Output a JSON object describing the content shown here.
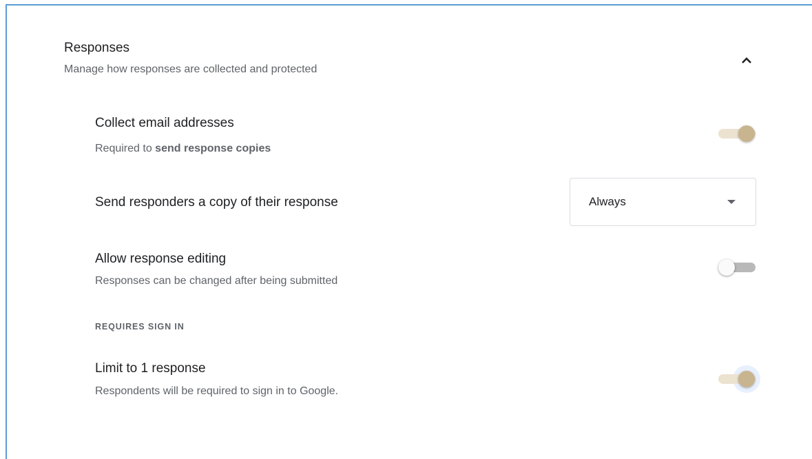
{
  "section": {
    "title": "Responses",
    "subtitle": "Manage how responses are collected and protected",
    "collapse_icon": "chevron-up-icon"
  },
  "settings": {
    "collect_email": {
      "title": "Collect email addresses",
      "subtitle_prefix": "Required to ",
      "subtitle_bold": "send response copies",
      "enabled": true
    },
    "send_copy": {
      "title": "Send responders a copy of their response",
      "selected_value": "Always"
    },
    "allow_editing": {
      "title": "Allow response editing",
      "subtitle": "Responses can be changed after being submitted",
      "enabled": false
    },
    "requires_sign_in_heading": "REQUIRES SIGN IN",
    "limit_response": {
      "title": "Limit to 1 response",
      "subtitle": "Respondents will be required to sign in to Google.",
      "enabled": true
    }
  },
  "colors": {
    "toggle_on_thumb": "#c8b48e",
    "toggle_on_track": "#ece2d0",
    "toggle_off_track": "#b9b9b9",
    "focus_halo": "#e8f0fe",
    "frame_border": "#5b9bd5"
  }
}
